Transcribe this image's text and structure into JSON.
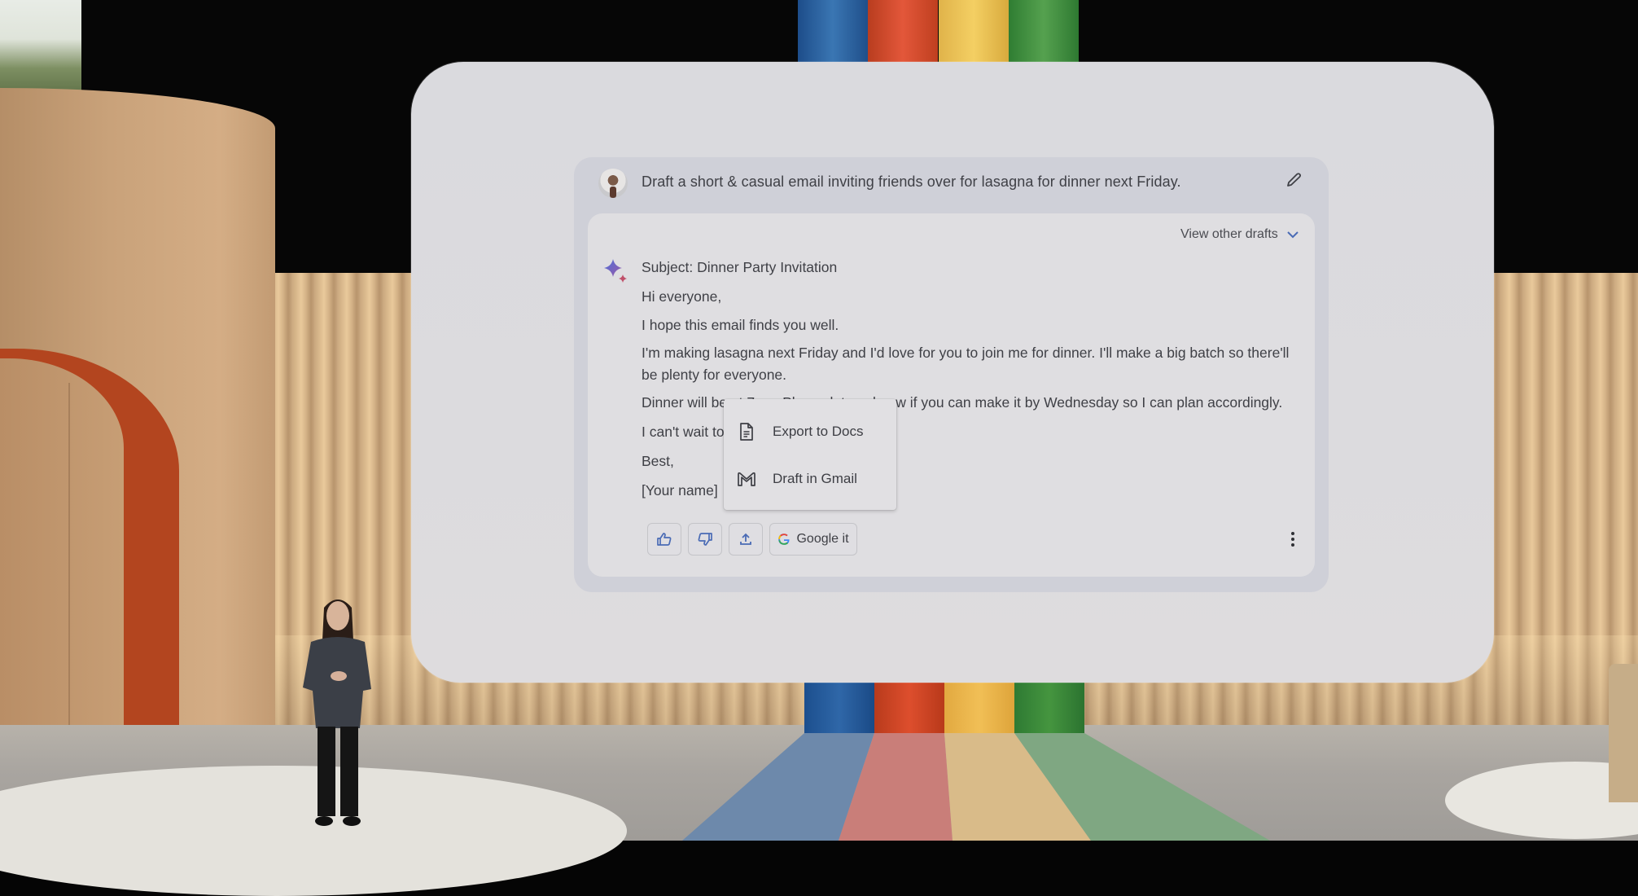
{
  "scene": {
    "description": "Keynote stage with large screen showing AI chat UI",
    "pillar_colors": [
      "#2f67a8",
      "#dd4e2d",
      "#f1bf56",
      "#45953f"
    ]
  },
  "prompt": {
    "avatar_icon": "user-avatar",
    "text": "Draft a short & casual email inviting friends over for lasagna for dinner next Friday.",
    "edit_icon": "pencil-icon"
  },
  "response": {
    "view_drafts_label": "View other drafts",
    "view_drafts_icon": "chevron-down-icon",
    "assistant_icon": "sparkle-icon",
    "email": {
      "subject": "Subject: Dinner Party Invitation",
      "greeting": "Hi everyone,",
      "p1": "I hope this email finds you well.",
      "p2_line1": "I'm making lasagna next Friday and I'd love for you to join me for dinner. I'll make a big batch so there'll",
      "p2_line2": "be plenty for everyone.",
      "p3": "Dinner will be at 7pm. Please let me know if you can make it by Wednesday so I can plan accordingly.",
      "p4": "I can't wait to see you!",
      "signoff": "Best,",
      "name": "[Your name]"
    },
    "actions": {
      "thumbs_up_icon": "thumbs-up-icon",
      "thumbs_down_icon": "thumbs-down-icon",
      "share_icon": "share-icon",
      "google_it_label": "Google it",
      "more_icon": "more-vert-icon"
    },
    "accent_color": "#4a6bb5"
  },
  "export_menu": {
    "items": [
      {
        "label": "Export to Docs",
        "icon": "docs-icon"
      },
      {
        "label": "Draft in Gmail",
        "icon": "gmail-icon"
      }
    ]
  }
}
